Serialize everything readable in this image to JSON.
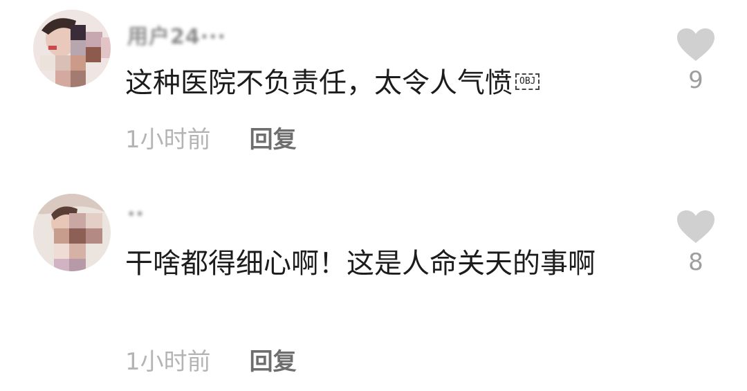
{
  "comments": [
    {
      "username": "用户24···",
      "text": "这种医院不负责任，太令人气愤",
      "object_marker": "OBJ",
      "time": "1小时前",
      "reply_label": "回复",
      "like_count": "9"
    },
    {
      "username": "··",
      "text": "干啥都得细心啊！这是人命关天的事啊",
      "time": "1小时前",
      "reply_label": "回复",
      "like_count": "8"
    }
  ],
  "colors": {
    "text_primary": "#1c1c1c",
    "text_meta": "#b4b4b4",
    "reply": "#6e6e6e",
    "heart": "#d0d0d0",
    "like_count": "#9e9e9e",
    "background": "#ffffff"
  },
  "icons": {
    "like": "heart-icon"
  }
}
